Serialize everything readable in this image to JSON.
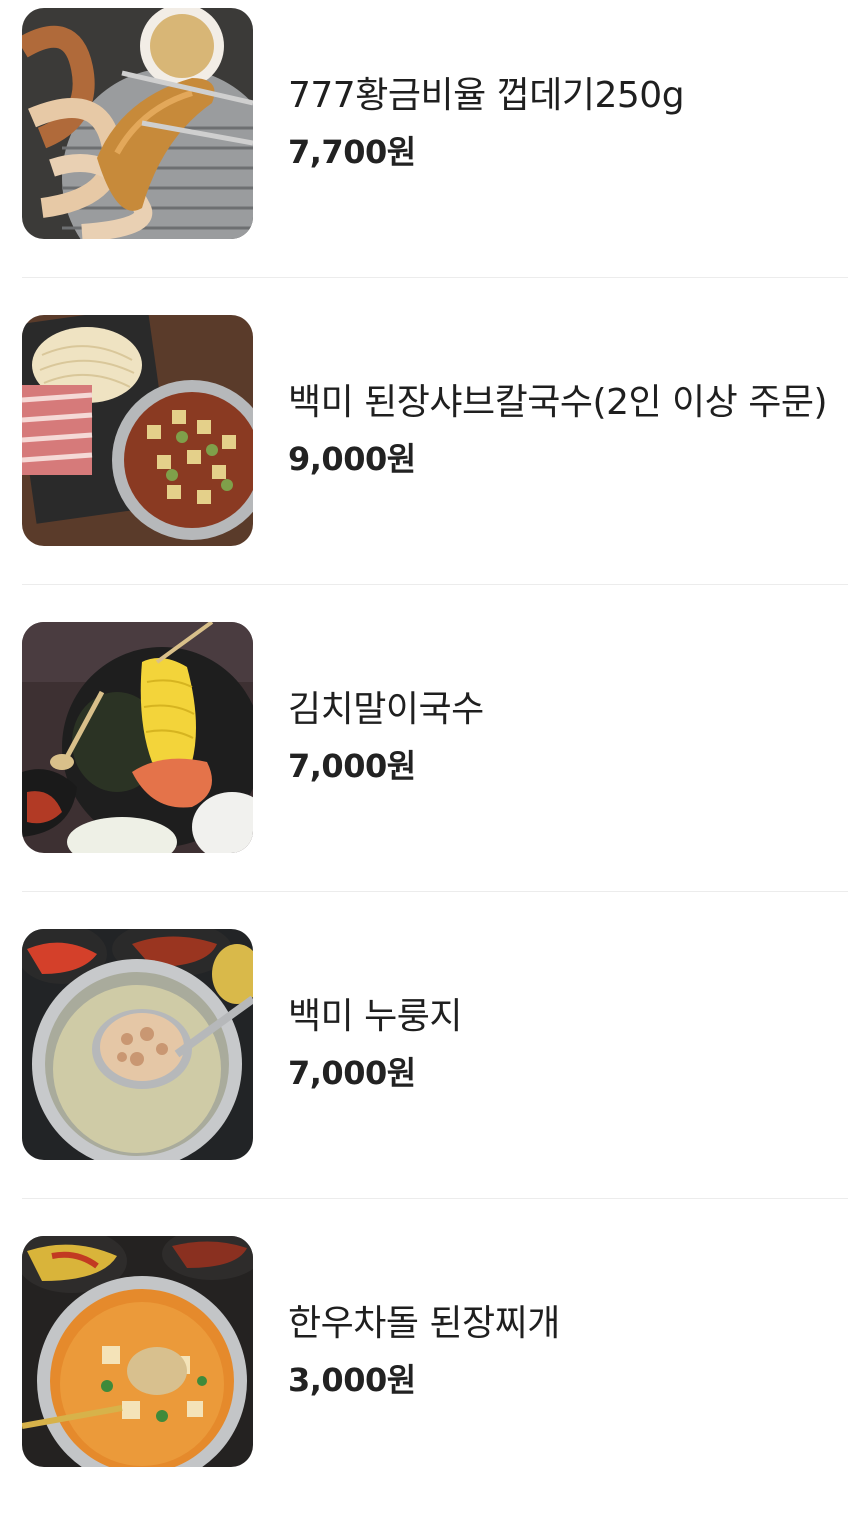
{
  "menu": {
    "items": [
      {
        "name": "777황금비율 껍데기250g",
        "price": "7,700원",
        "photo_icon": "grilled-pork-skin-photo"
      },
      {
        "name": "백미 된장샤브칼국수(2인 이상 주문)",
        "price": "9,000원",
        "photo_icon": "shabu-kalguksu-photo"
      },
      {
        "name": "김치말이국수",
        "price": "7,000원",
        "photo_icon": "kimchi-noodles-photo"
      },
      {
        "name": "백미 누룽지",
        "price": "7,000원",
        "photo_icon": "nurungji-photo"
      },
      {
        "name": "한우차돌 된장찌개",
        "price": "3,000원",
        "photo_icon": "doenjang-jjigae-photo"
      }
    ]
  }
}
